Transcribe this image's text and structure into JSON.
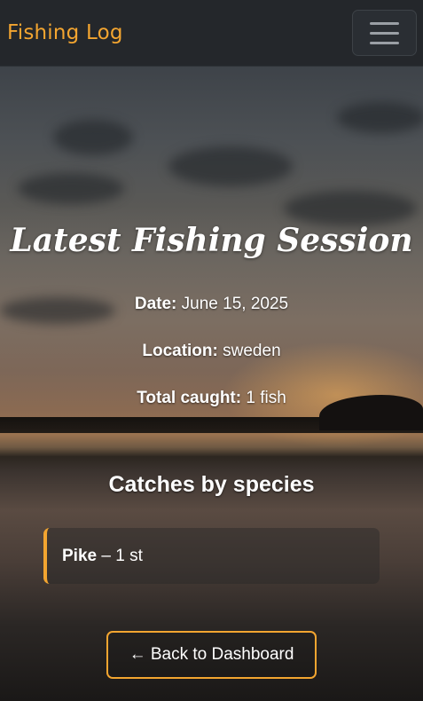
{
  "navbar": {
    "brand": "Fishing Log",
    "menu_icon": "hamburger-menu-icon"
  },
  "session": {
    "title": "Latest Fishing Session",
    "date_label": "Date:",
    "date_value": "June 15, 2025",
    "location_label": "Location:",
    "location_value": "sweden",
    "total_label": "Total caught:",
    "total_value": "1 fish"
  },
  "catches": {
    "heading": "Catches by species",
    "items": [
      {
        "species": "Pike",
        "separator": "–",
        "count": "1 st"
      }
    ]
  },
  "actions": {
    "back_label": "← Back to Dashboard"
  },
  "colors": {
    "accent": "#f3a530",
    "navbar_bg": "#24272b"
  }
}
